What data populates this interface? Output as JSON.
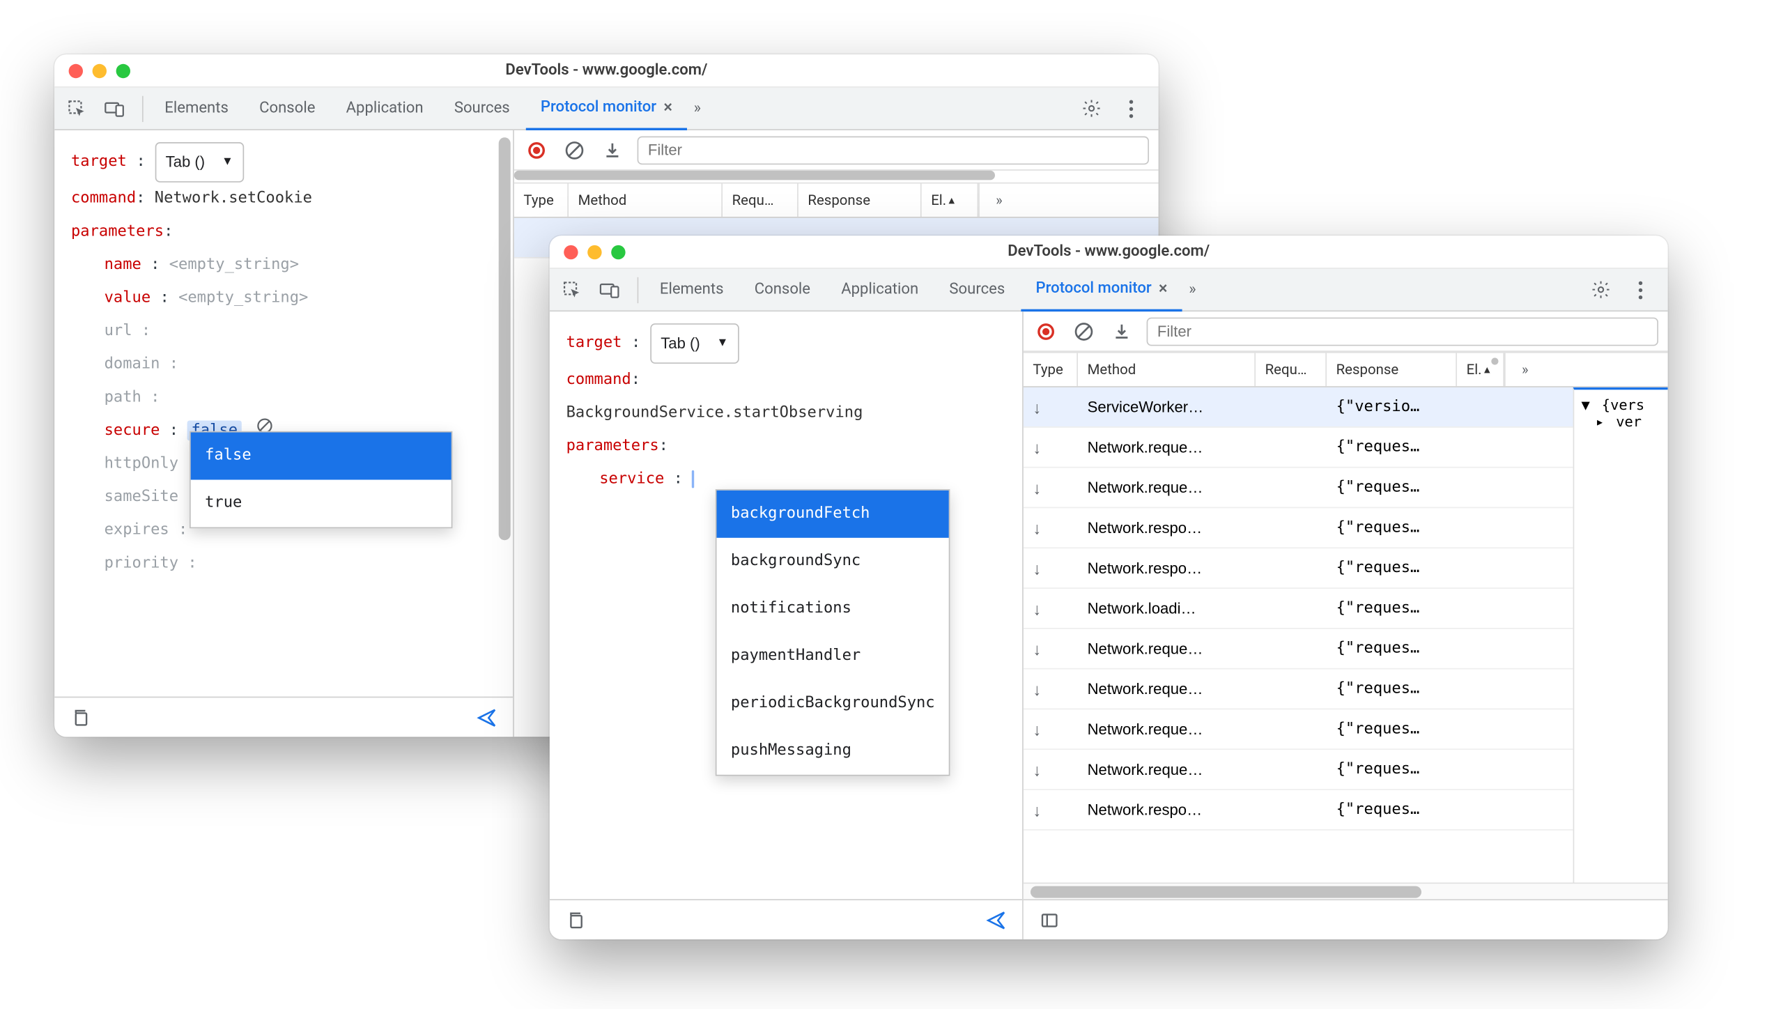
{
  "windowA": {
    "title": "DevTools - www.google.com/",
    "tabs": [
      "Elements",
      "Console",
      "Application",
      "Sources"
    ],
    "active_tab": "Protocol monitor",
    "editor": {
      "target_label": "target",
      "target_value": "Tab ()",
      "command_label": "command",
      "command_value": "Network.setCookie",
      "parameters_label": "parameters",
      "params": {
        "name": {
          "label": "name",
          "value": "<empty_string>"
        },
        "value": {
          "label": "value",
          "value": "<empty_string>"
        },
        "url": {
          "label": "url",
          "value": ""
        },
        "domain": {
          "label": "domain",
          "value": ""
        },
        "path": {
          "label": "path",
          "value": ""
        },
        "secure": {
          "label": "secure",
          "value": "false"
        },
        "httpOnly": {
          "label": "httpOnly",
          "value": ""
        },
        "sameSite": {
          "label": "sameSite",
          "value": ""
        },
        "expires": {
          "label": "expires",
          "value": ""
        },
        "priority": {
          "label": "priority",
          "value": ""
        }
      },
      "autocomplete": [
        "false",
        "true"
      ]
    },
    "rightToolbar": {
      "filter_placeholder": "Filter"
    },
    "gridHeaders": {
      "type": "Type",
      "method": "Method",
      "req": "Requ…",
      "resp": "Response",
      "el": "El."
    }
  },
  "windowB": {
    "title": "DevTools - www.google.com/",
    "tabs": [
      "Elements",
      "Console",
      "Application",
      "Sources"
    ],
    "active_tab": "Protocol monitor",
    "editor": {
      "target_label": "target",
      "target_value": "Tab ()",
      "command_label": "command",
      "command_value": "BackgroundService.startObserving",
      "parameters_label": "parameters",
      "params": {
        "service": {
          "label": "service",
          "value": ""
        }
      },
      "autocomplete": [
        "backgroundFetch",
        "backgroundSync",
        "notifications",
        "paymentHandler",
        "periodicBackgroundSync",
        "pushMessaging"
      ]
    },
    "rightToolbar": {
      "filter_placeholder": "Filter"
    },
    "gridHeaders": {
      "type": "Type",
      "method": "Method",
      "req": "Requ…",
      "resp": "Response",
      "el": "El."
    },
    "rows": [
      {
        "method": "ServiceWorker…",
        "resp": "{\"versio…",
        "selected": true
      },
      {
        "method": "Network.reque…",
        "resp": "{\"reques…"
      },
      {
        "method": "Network.reque…",
        "resp": "{\"reques…"
      },
      {
        "method": "Network.respo…",
        "resp": "{\"reques…"
      },
      {
        "method": "Network.respo…",
        "resp": "{\"reques…"
      },
      {
        "method": "Network.loadi…",
        "resp": "{\"reques…"
      },
      {
        "method": "Network.reque…",
        "resp": "{\"reques…"
      },
      {
        "method": "Network.reque…",
        "resp": "{\"reques…"
      },
      {
        "method": "Network.reque…",
        "resp": "{\"reques…"
      },
      {
        "method": "Network.reque…",
        "resp": "{\"reques…"
      },
      {
        "method": "Network.respo…",
        "resp": "{\"reques…"
      }
    ],
    "tree": {
      "root": "{vers",
      "child": "ver"
    }
  }
}
